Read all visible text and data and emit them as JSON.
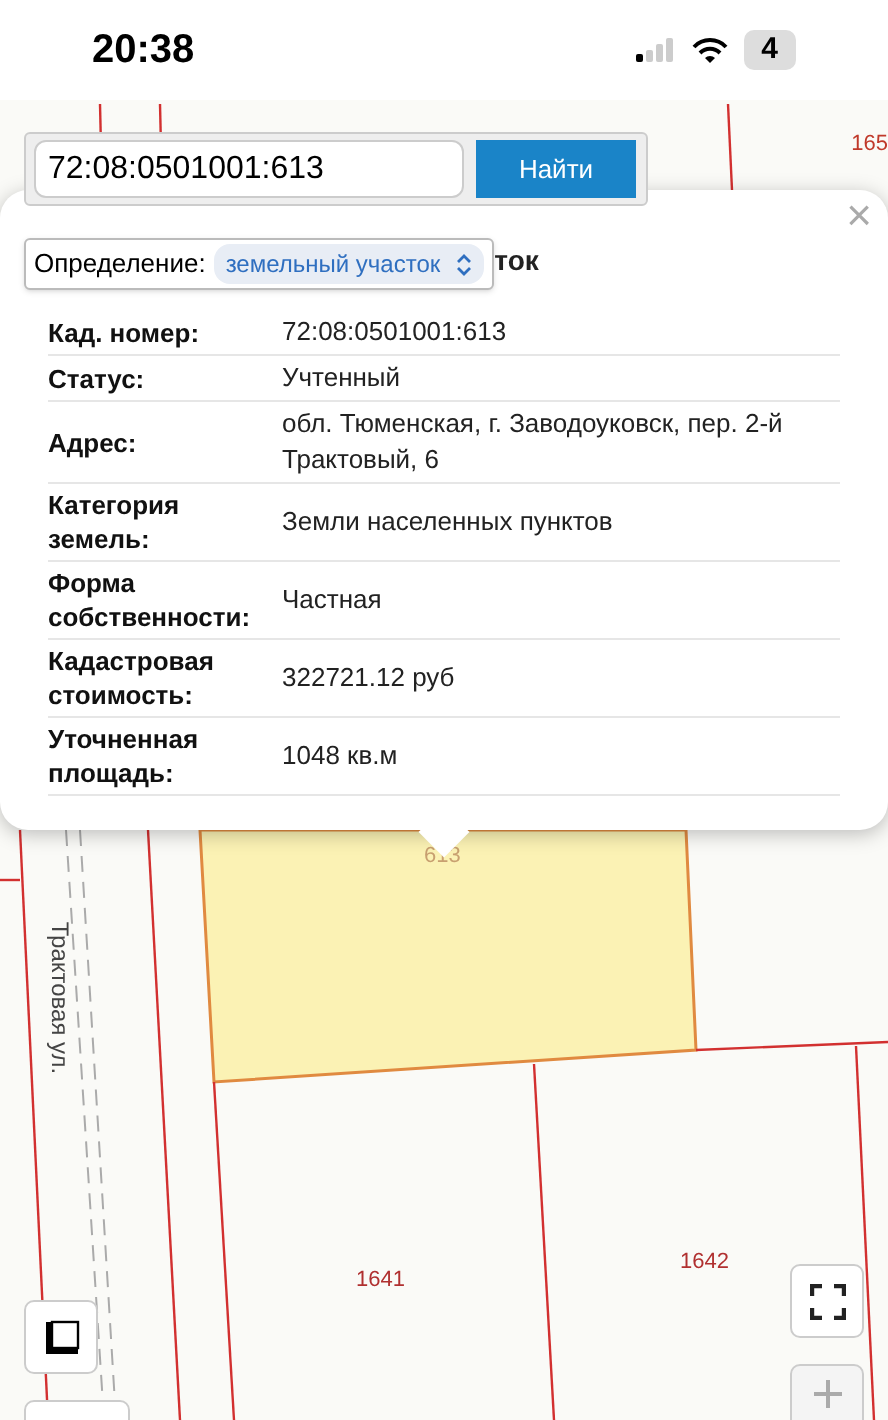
{
  "status_bar": {
    "time": "20:38",
    "battery": "4"
  },
  "search": {
    "value": "72:08:0501001:613",
    "button": "Найти"
  },
  "popup": {
    "title_fragment": "ток",
    "close": "×",
    "definition_label": "Определение:",
    "definition_value": "земельный участок",
    "rows": [
      {
        "label": "Кад. номер:",
        "value": "72:08:0501001:613"
      },
      {
        "label": "Статус:",
        "value": "Учтенный"
      },
      {
        "label": "Адрес:",
        "value": "обл. Тюменская, г. Заводоуковск, пер. 2-й Трактовый, 6"
      },
      {
        "label": "Категория земель:",
        "value": "Земли населенных пунктов"
      },
      {
        "label": "Форма собственности:",
        "value": "Частная"
      },
      {
        "label": "Кадастровая стоимость:",
        "value": "322721.12 руб"
      },
      {
        "label": "Уточненная площадь:",
        "value": "1048 кв.м"
      }
    ]
  },
  "map": {
    "street": "Трактовая ул.",
    "parcels": [
      "165",
      "613",
      "1641",
      "1642"
    ]
  }
}
